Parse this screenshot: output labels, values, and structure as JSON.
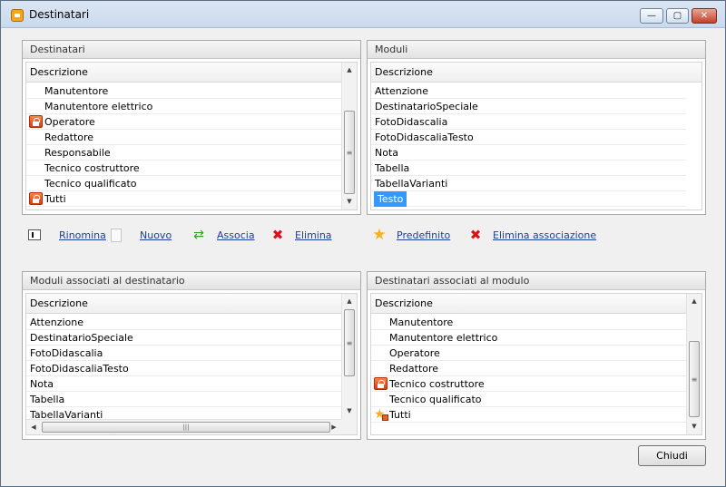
{
  "window": {
    "title": "Destinatari",
    "controls": {
      "minimize": "—",
      "maximize": "▢",
      "close": "✕"
    }
  },
  "panels": {
    "destinatari": {
      "title": "Destinatari",
      "column": "Descrizione",
      "rows": [
        {
          "label": "Manutentore",
          "icon": ""
        },
        {
          "label": "Manutentore elettrico",
          "icon": ""
        },
        {
          "label": "Operatore",
          "icon": "lock-icon"
        },
        {
          "label": "Redattore",
          "icon": ""
        },
        {
          "label": "Responsabile",
          "icon": ""
        },
        {
          "label": "Tecnico costruttore",
          "icon": ""
        },
        {
          "label": "Tecnico qualificato",
          "icon": ""
        },
        {
          "label": "Tutti",
          "icon": "lock-icon"
        }
      ]
    },
    "moduli": {
      "title": "Moduli",
      "column": "Descrizione",
      "rows": [
        {
          "label": "Attenzione"
        },
        {
          "label": "DestinatarioSpeciale"
        },
        {
          "label": "FotoDidascalia"
        },
        {
          "label": "FotoDidascaliaTesto"
        },
        {
          "label": "Nota"
        },
        {
          "label": "Tabella"
        },
        {
          "label": "TabellaVarianti"
        },
        {
          "label": "Testo",
          "selected": true
        }
      ]
    },
    "moduli_associati": {
      "title": "Moduli associati al destinatario",
      "column": "Descrizione",
      "rows": [
        {
          "label": "Attenzione"
        },
        {
          "label": "DestinatarioSpeciale"
        },
        {
          "label": "FotoDidascalia"
        },
        {
          "label": "FotoDidascaliaTesto"
        },
        {
          "label": "Nota"
        },
        {
          "label": "Tabella"
        },
        {
          "label": "TabellaVarianti"
        }
      ]
    },
    "destinatari_associati": {
      "title": "Destinatari associati al modulo",
      "column": "Descrizione",
      "rows": [
        {
          "label": "Manutentore",
          "icon": ""
        },
        {
          "label": "Manutentore elettrico",
          "icon": ""
        },
        {
          "label": "Operatore",
          "icon": ""
        },
        {
          "label": "Redattore",
          "icon": ""
        },
        {
          "label": "Tecnico costruttore",
          "icon": "lock-icon"
        },
        {
          "label": "Tecnico qualificato",
          "icon": ""
        },
        {
          "label": "Tutti",
          "icon": "star-lock-icon"
        }
      ]
    }
  },
  "actions": {
    "rinomina": "Rinomina",
    "nuovo": "Nuovo",
    "associa": "Associa",
    "elimina": "Elimina",
    "predefinito": "Predefinito",
    "elimina_associazione": "Elimina associazione"
  },
  "footer": {
    "close_label": "Chiudi"
  },
  "colors": {
    "selection": "#3399ff",
    "link": "#1a3f9c",
    "lock": "#d53d13",
    "star": "#f5b11d"
  }
}
